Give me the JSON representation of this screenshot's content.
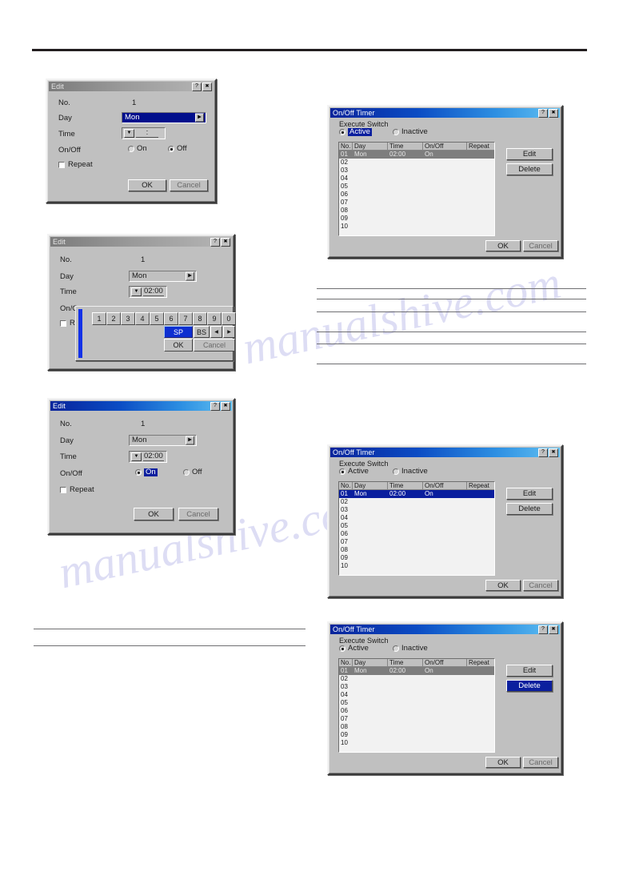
{
  "page": {
    "rules": {
      "top_rule": "",
      "note_lines_right": "",
      "note_lines_left": ""
    },
    "watermark": "manualshive.com"
  },
  "icons": {
    "help": "?",
    "close": "✕",
    "dropdown_right": "▶",
    "dropdown_down": "▼",
    "arrow_left": "◀",
    "arrow_right": "▶"
  },
  "edit_dialog_empty": {
    "title": "Edit",
    "active": false,
    "fields": {
      "no_label": "No.",
      "no_value": "1",
      "day_label": "Day",
      "day_value": "Mon",
      "time_label": "Time",
      "time_value": ":",
      "onoff_label": "On/Off",
      "on_label": "On",
      "off_label": "Off",
      "selected_onoff": "Off",
      "repeat_label": "Repeat",
      "repeat_checked": false
    },
    "buttons": {
      "ok": "OK",
      "cancel": "Cancel"
    }
  },
  "edit_dialog_keypad": {
    "title": "Edit",
    "active": false,
    "fields": {
      "no_label": "No.",
      "no_value": "1",
      "day_label": "Day",
      "day_value": "Mon",
      "time_label": "Time",
      "time_value": "02:00",
      "onoff_label": "On/O",
      "repeat_label": "R"
    },
    "keypad": {
      "digits": [
        "1",
        "2",
        "3",
        "4",
        "5",
        "6",
        "7",
        "8",
        "9",
        "0"
      ],
      "sp": "SP",
      "bs": "BS",
      "left": "◀",
      "right": "▶",
      "ok": "OK",
      "cancel": "Cancel",
      "highlighted": "SP"
    }
  },
  "edit_dialog_on": {
    "title": "Edit",
    "active": true,
    "fields": {
      "no_label": "No.",
      "no_value": "1",
      "day_label": "Day",
      "day_value": "Mon",
      "time_label": "Time",
      "time_value": "02:00",
      "onoff_label": "On/Off",
      "on_label": "On",
      "off_label": "Off",
      "selected_onoff": "On",
      "repeat_label": "Repeat",
      "repeat_checked": false
    },
    "buttons": {
      "ok": "OK",
      "cancel": "Cancel"
    }
  },
  "timer_dialog_active": {
    "title": "On/Off Timer",
    "active": true,
    "execute_switch_label": "Execute Switch",
    "active_label": "Active",
    "inactive_label": "Inactive",
    "selected_switch": "Active",
    "highlight": "active-radio",
    "columns": [
      "No.",
      "Day",
      "Time",
      "On/Off",
      "Repeat"
    ],
    "rows": [
      {
        "no": "01",
        "day": "Mon",
        "time": "02:00",
        "onoff": "On",
        "repeat": ""
      },
      {
        "no": "02",
        "day": "",
        "time": "",
        "onoff": "",
        "repeat": ""
      },
      {
        "no": "03",
        "day": "",
        "time": "",
        "onoff": "",
        "repeat": ""
      },
      {
        "no": "04",
        "day": "",
        "time": "",
        "onoff": "",
        "repeat": ""
      },
      {
        "no": "05",
        "day": "",
        "time": "",
        "onoff": "",
        "repeat": ""
      },
      {
        "no": "06",
        "day": "",
        "time": "",
        "onoff": "",
        "repeat": ""
      },
      {
        "no": "07",
        "day": "",
        "time": "",
        "onoff": "",
        "repeat": ""
      },
      {
        "no": "08",
        "day": "",
        "time": "",
        "onoff": "",
        "repeat": ""
      },
      {
        "no": "09",
        "day": "",
        "time": "",
        "onoff": "",
        "repeat": ""
      },
      {
        "no": "10",
        "day": "",
        "time": "",
        "onoff": "",
        "repeat": ""
      }
    ],
    "selected_row_index": 0,
    "selected_row_style": "gray",
    "buttons": {
      "edit": "Edit",
      "delete": "Delete",
      "ok": "OK",
      "cancel": "Cancel"
    },
    "highlighted_button": ""
  },
  "timer_dialog_rowselected": {
    "title": "On/Off Timer",
    "active": true,
    "execute_switch_label": "Execute Switch",
    "active_label": "Active",
    "inactive_label": "Inactive",
    "selected_switch": "Active",
    "columns": [
      "No.",
      "Day",
      "Time",
      "On/Off",
      "Repeat"
    ],
    "rows": [
      {
        "no": "01",
        "day": "Mon",
        "time": "02:00",
        "onoff": "On",
        "repeat": ""
      },
      {
        "no": "02",
        "day": "",
        "time": "",
        "onoff": "",
        "repeat": ""
      },
      {
        "no": "03",
        "day": "",
        "time": "",
        "onoff": "",
        "repeat": ""
      },
      {
        "no": "04",
        "day": "",
        "time": "",
        "onoff": "",
        "repeat": ""
      },
      {
        "no": "05",
        "day": "",
        "time": "",
        "onoff": "",
        "repeat": ""
      },
      {
        "no": "06",
        "day": "",
        "time": "",
        "onoff": "",
        "repeat": ""
      },
      {
        "no": "07",
        "day": "",
        "time": "",
        "onoff": "",
        "repeat": ""
      },
      {
        "no": "08",
        "day": "",
        "time": "",
        "onoff": "",
        "repeat": ""
      },
      {
        "no": "09",
        "day": "",
        "time": "",
        "onoff": "",
        "repeat": ""
      },
      {
        "no": "10",
        "day": "",
        "time": "",
        "onoff": "",
        "repeat": ""
      }
    ],
    "selected_row_index": 0,
    "selected_row_style": "blue",
    "buttons": {
      "edit": "Edit",
      "delete": "Delete",
      "ok": "OK",
      "cancel": "Cancel"
    },
    "highlighted_button": ""
  },
  "timer_dialog_delete": {
    "title": "On/Off Timer",
    "active": true,
    "execute_switch_label": "Execute Switch",
    "active_label": "Active",
    "inactive_label": "Inactive",
    "selected_switch": "Active",
    "columns": [
      "No.",
      "Day",
      "Time",
      "On/Off",
      "Repeat"
    ],
    "rows": [
      {
        "no": "01",
        "day": "Mon",
        "time": "02:00",
        "onoff": "On",
        "repeat": ""
      },
      {
        "no": "02",
        "day": "",
        "time": "",
        "onoff": "",
        "repeat": ""
      },
      {
        "no": "03",
        "day": "",
        "time": "",
        "onoff": "",
        "repeat": ""
      },
      {
        "no": "04",
        "day": "",
        "time": "",
        "onoff": "",
        "repeat": ""
      },
      {
        "no": "05",
        "day": "",
        "time": "",
        "onoff": "",
        "repeat": ""
      },
      {
        "no": "06",
        "day": "",
        "time": "",
        "onoff": "",
        "repeat": ""
      },
      {
        "no": "07",
        "day": "",
        "time": "",
        "onoff": "",
        "repeat": ""
      },
      {
        "no": "08",
        "day": "",
        "time": "",
        "onoff": "",
        "repeat": ""
      },
      {
        "no": "09",
        "day": "",
        "time": "",
        "onoff": "",
        "repeat": ""
      },
      {
        "no": "10",
        "day": "",
        "time": "",
        "onoff": "",
        "repeat": ""
      }
    ],
    "selected_row_index": 0,
    "selected_row_style": "gray",
    "buttons": {
      "edit": "Edit",
      "delete": "Delete",
      "ok": "OK",
      "cancel": "Cancel"
    },
    "highlighted_button": "Delete"
  },
  "colors": {
    "title_active_start": "#09249b",
    "title_active_end": "#63c2f2",
    "title_inactive": "#9a9a9a",
    "selection_blue": "#0b1f9e",
    "selection_gray": "#7e7e7e",
    "dialog_face": "#c0c0c0",
    "keypad_accent": "#1331e8"
  }
}
